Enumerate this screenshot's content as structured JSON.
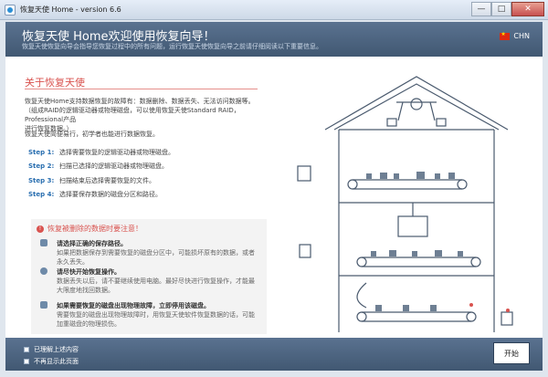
{
  "window": {
    "title": "恢复天使 Home - version 6.6",
    "minimize": "—",
    "maximize": "□",
    "close": "✕"
  },
  "header": {
    "title": "恢复天使 Home欢迎使用恢复向导！",
    "subtitle": "恢复天使恢复向导会指导您恢复过程中的所有问题，运行恢复天使恢复向导之前请仔细阅读以下重要信息。",
    "language": "CHN"
  },
  "about": {
    "title": "关于恢复天使",
    "para1_line1": "恢复天使Home支持数据恢复的故障有：数据删除、数据丢失、无法访问数据等。",
    "para1_line2": "（组成RAID的逻辑驱动器或物理磁盘，可以使用恢复天使Standard RAID，Professional产品",
    "para1_line3": "进行恢复数据。）",
    "para2": "恢复天使简便易行，初学者也能进行数据恢复。"
  },
  "steps": [
    {
      "label": "Step 1:",
      "text": "选择需要恢复的逻辑驱动器或物理磁盘。"
    },
    {
      "label": "Step 2:",
      "text": "扫描已选择的逻辑驱动器或物理磁盘。"
    },
    {
      "label": "Step 3:",
      "text": "扫描结束后选择需要恢复的文件。"
    },
    {
      "label": "Step 4:",
      "text": "选择要保存数据的磁盘分区和路径。"
    }
  ],
  "warning": {
    "title": "恢复被删除的数据时要注意！",
    "tips": [
      {
        "title": "请选择正确的保存路径。",
        "text": "如果把数据保存到需要恢复的磁盘分区中，可能损坏原有的数据，或者永久丢失。"
      },
      {
        "title": "请尽快开始恢复操作。",
        "text": "数据丢失以后，请不要继续使用电脑。最好尽快进行恢复操作，才能最大限度地找回数据。"
      },
      {
        "title": "如果需要恢复的磁盘出现物理故障，立即停用该磁盘。",
        "text": "需要恢复的磁盘出现物理故障时，用恢复天使软件恢复数据的话，可能加重磁盘的物理损伤。"
      }
    ]
  },
  "footer": {
    "check1": "已理解上述内容",
    "check2": "不再显示此页面",
    "start": "开始"
  },
  "colors": {
    "accent_red": "#d9534f",
    "header_blue": "#4a6280",
    "step_blue": "#2a6fb0"
  }
}
